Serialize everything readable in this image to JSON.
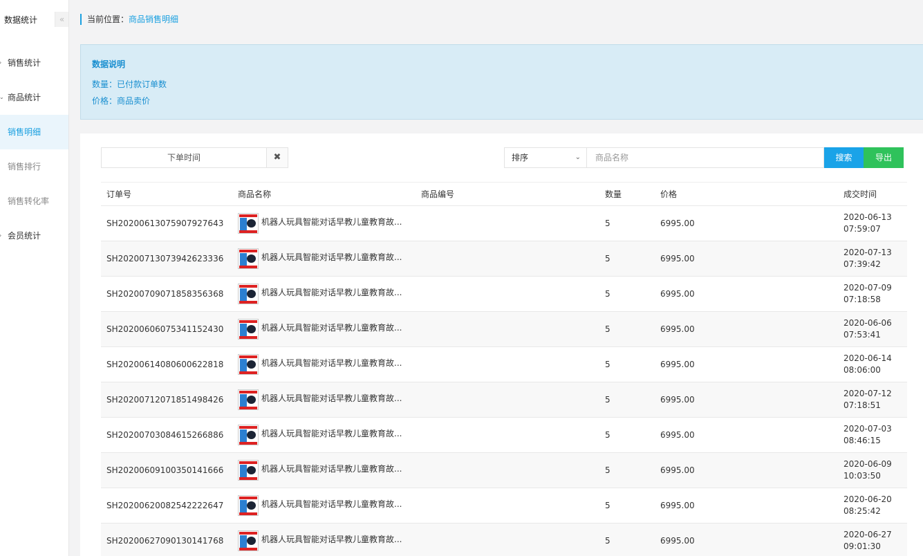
{
  "sidebar": {
    "title": "数据统计",
    "collapse_icon": "«",
    "items": [
      {
        "label": "销售统计",
        "arrow": "›"
      },
      {
        "label": "商品统计",
        "arrow": "⌄"
      },
      {
        "label": "销售明细"
      },
      {
        "label": "销售排行"
      },
      {
        "label": "销售转化率"
      },
      {
        "label": "会员统计",
        "arrow": "›"
      }
    ]
  },
  "breadcrumb": {
    "prefix": "当前位置：",
    "current": "商品销售明细"
  },
  "info": {
    "title": "数据说明",
    "lines": [
      "数量：已付款订单数",
      "价格：商品卖价"
    ]
  },
  "filters": {
    "date_placeholder": "下单时间",
    "clear_icon": "✖",
    "sort_label": "排序",
    "sort_chevron": "⌄",
    "search_placeholder": "商品名称",
    "search_button": "搜索",
    "export_button": "导出"
  },
  "table": {
    "headers": {
      "order_no": "订单号",
      "name": "商品名称",
      "code": "商品编号",
      "qty": "数量",
      "price": "价格",
      "time": "成交时间"
    },
    "rows": [
      {
        "order_no": "SH2020061307590792764З",
        "name": "机器人玩具智能对话早教儿童教育故...",
        "qty": "5",
        "price": "6995.00",
        "date": "2020-06-13",
        "clock": "07:59:07"
      },
      {
        "order_no": "SH2020071307394262333б",
        "name": "机器人玩具智能对话早教儿童教育故...",
        "qty": "5",
        "price": "6995.00",
        "date": "2020-07-13",
        "clock": "07:39:42"
      },
      {
        "order_no": "SH20200709071858356368",
        "name": "机器人玩具智能对话早教儿童教育故...",
        "qty": "5",
        "price": "6995.00",
        "date": "2020-07-09",
        "clock": "07:18:58"
      },
      {
        "order_no": "SH20200606075341152430",
        "name": "机器人玩具智能对话早教儿童教育故...",
        "qty": "5",
        "price": "6995.00",
        "date": "2020-06-06",
        "clock": "07:53:41"
      },
      {
        "order_no": "SH20200614080600622818",
        "name": "机器人玩具智能对话早教儿童教育故...",
        "qty": "5",
        "price": "6995.00",
        "date": "2020-06-14",
        "clock": "08:06:00"
      },
      {
        "order_no": "SH20200712071851498426",
        "name": "机器人玩具智能对话早教儿童教育故...",
        "qty": "5",
        "price": "6995.00",
        "date": "2020-07-12",
        "clock": "07:18:51"
      },
      {
        "order_no": "SH20200703084615266886",
        "name": "机器人玩具智能对话早教儿童教育故...",
        "qty": "5",
        "price": "6995.00",
        "date": "2020-07-03",
        "clock": "08:46:15"
      },
      {
        "order_no": "SH20200609100350141666",
        "name": "机器人玩具智能对话早教儿童教育故...",
        "qty": "5",
        "price": "6995.00",
        "date": "2020-06-09",
        "clock": "10:03:50"
      },
      {
        "order_no": "SH20200620082542222647",
        "name": "机器人玩具智能对话早教儿童教育故...",
        "qty": "5",
        "price": "6995.00",
        "date": "2020-06-20",
        "clock": "08:25:42"
      },
      {
        "order_no": "SH20200627090130141768",
        "name": "机器人玩具智能对话早教儿童教育故...",
        "qty": "5",
        "price": "6995.00",
        "date": "2020-06-27",
        "clock": "09:01:30"
      }
    ]
  }
}
